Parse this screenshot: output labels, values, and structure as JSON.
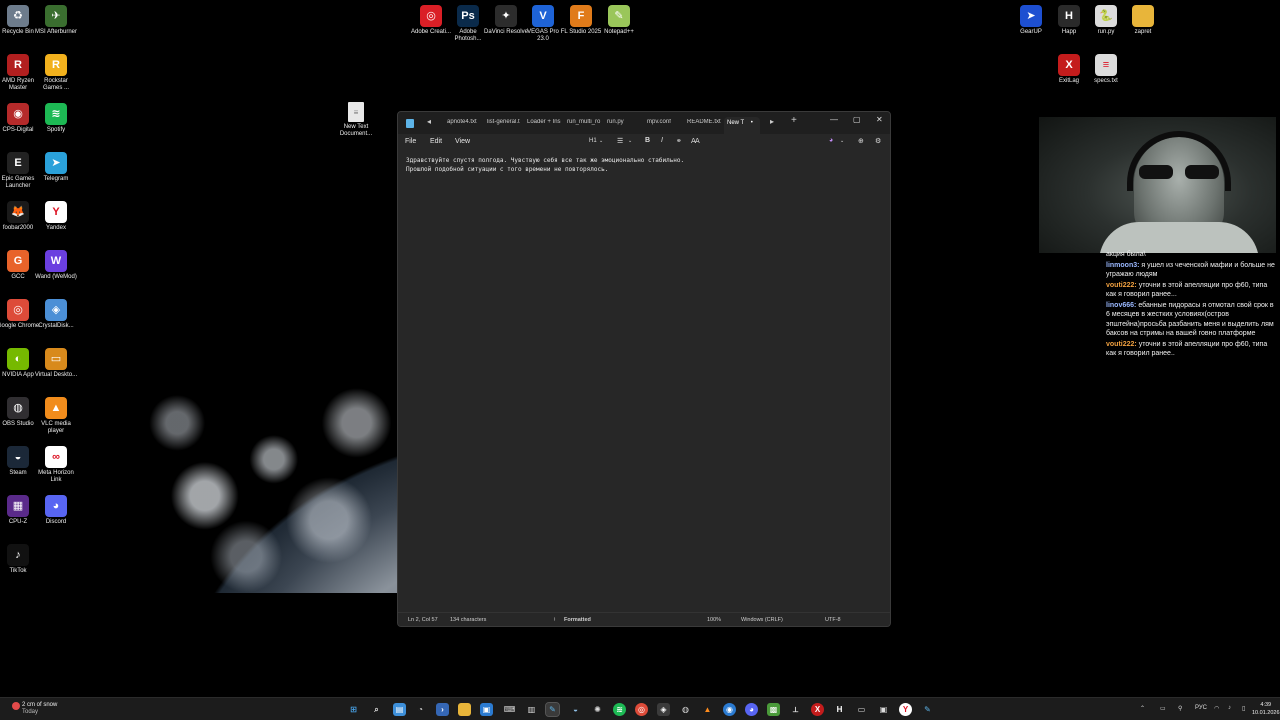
{
  "desktop": {
    "left_icons": [
      {
        "label": "Recycle Bin",
        "icon": "recycle-bin-icon",
        "color": "#6d7c8c",
        "glyph": "♻"
      },
      {
        "label": "MSI Afterburner",
        "icon": "msi-afterburner-icon",
        "color": "#3a6e2f",
        "glyph": "✈"
      },
      {
        "label": "AMD Ryzen Master",
        "icon": "amd-ryzen-icon",
        "color": "#b21f1f",
        "glyph": "R"
      },
      {
        "label": "Rockstar Games ...",
        "icon": "rockstar-icon",
        "color": "#f2b11d",
        "glyph": "R"
      },
      {
        "label": "CPS-Digital",
        "icon": "cps-digital-icon",
        "color": "#b52a2a",
        "glyph": "◉"
      },
      {
        "label": "Spotify",
        "icon": "spotify-icon",
        "color": "#1db954",
        "glyph": "≋"
      },
      {
        "label": "Epic Games Launcher",
        "icon": "epic-games-icon",
        "color": "#222222",
        "glyph": "E"
      },
      {
        "label": "Telegram",
        "icon": "telegram-icon",
        "color": "#2aa1da",
        "glyph": "➤"
      },
      {
        "label": "foobar2000",
        "icon": "foobar-icon",
        "color": "#1a1a1a",
        "glyph": "🦊"
      },
      {
        "label": "Yandex",
        "icon": "yandex-icon",
        "color": "#ffffff",
        "glyph": "Y"
      },
      {
        "label": "GCC",
        "icon": "gcc-icon",
        "color": "#e8632a",
        "glyph": "G"
      },
      {
        "label": "Wand (WeMod)",
        "icon": "wand-icon",
        "color": "#6b3fe0",
        "glyph": "W"
      },
      {
        "label": "Google Chrome",
        "icon": "chrome-icon",
        "color": "#dd4b39",
        "glyph": "◎"
      },
      {
        "label": "CrystalDisk...",
        "icon": "crystaldisk-icon",
        "color": "#4b8fd6",
        "glyph": "◈"
      },
      {
        "label": "NVIDIA App",
        "icon": "nvidia-icon",
        "color": "#76b900",
        "glyph": "◐"
      },
      {
        "label": "Virtual Deskto...",
        "icon": "virtual-desktop-icon",
        "color": "#d88a1c",
        "glyph": "▭"
      },
      {
        "label": "OBS Studio",
        "icon": "obs-icon",
        "color": "#302e31",
        "glyph": "◍"
      },
      {
        "label": "VLC media player",
        "icon": "vlc-icon",
        "color": "#f18c1c",
        "glyph": "▲"
      },
      {
        "label": "Steam",
        "icon": "steam-icon",
        "color": "#1b2838",
        "glyph": "◒"
      },
      {
        "label": "Meta Horizon Link",
        "icon": "meta-icon",
        "color": "#ffffff",
        "glyph": "∞"
      },
      {
        "label": "CPU-Z",
        "icon": "cpuz-icon",
        "color": "#5a2a8a",
        "glyph": "▦"
      },
      {
        "label": "Discord",
        "icon": "discord-icon",
        "color": "#5865f2",
        "glyph": "◕"
      },
      {
        "label": "TikTok",
        "icon": "tiktok-icon",
        "color": "#111111",
        "glyph": "♪"
      }
    ],
    "top_icons": [
      {
        "label": "Adobe Creati...",
        "icon": "adobe-cc-icon",
        "color": "#da1f26",
        "glyph": "◎"
      },
      {
        "label": "Adobe Photosh...",
        "icon": "photoshop-icon",
        "color": "#0a2a4a",
        "glyph": "Ps"
      },
      {
        "label": "DaVinci Resolve",
        "icon": "davinci-icon",
        "color": "#2c2c2c",
        "glyph": "✦"
      },
      {
        "label": "VEGAS Pro 23.0",
        "icon": "vegas-icon",
        "color": "#1e63d6",
        "glyph": "V"
      },
      {
        "label": "FL Studio 2025",
        "icon": "flstudio-icon",
        "color": "#e07b1a",
        "glyph": "F"
      },
      {
        "label": "Notepad++",
        "icon": "notepadpp-icon",
        "color": "#9ac65a",
        "glyph": "✎"
      }
    ],
    "right_icons": [
      {
        "label": "GearUP",
        "icon": "gearup-icon",
        "color": "#1d4fd1",
        "glyph": "➤"
      },
      {
        "label": "Happ",
        "icon": "happ-icon",
        "color": "#2a2a2a",
        "glyph": "H"
      },
      {
        "label": "run.py",
        "icon": "python-file-icon",
        "color": "#dcdcdc",
        "glyph": "🐍"
      },
      {
        "label": "zapret",
        "icon": "folder-icon",
        "color": "#e8b53a",
        "glyph": ""
      },
      {
        "label": "ExitLag",
        "icon": "exitlag-icon",
        "color": "#c41c1c",
        "glyph": "X"
      },
      {
        "label": "specs.txt",
        "icon": "text-file-icon",
        "color": "#dcdcdc",
        "glyph": "≡"
      }
    ],
    "file_icon": {
      "label": "New Text Document...",
      "icon": "text-file-icon"
    }
  },
  "notepad": {
    "tabs": [
      {
        "label": "apnote4.txt"
      },
      {
        "label": "list-general.t"
      },
      {
        "label": "Loader + Ins"
      },
      {
        "label": "run_multi_ro"
      },
      {
        "label": "run.py"
      },
      {
        "label": "mpv.conf"
      },
      {
        "label": "README.txt"
      },
      {
        "label": "New T"
      }
    ],
    "menu": {
      "file": "File",
      "edit": "Edit",
      "view": "View"
    },
    "format_heading": "H1",
    "format_bold": "B",
    "format_italic": "I",
    "content_lines": [
      "Здравствуйте спустя полгода. Чувствую себя все так же эмоционально стабильно.",
      "Прошлой подобной ситуации с того времени не повторялось."
    ],
    "status": {
      "position": "Ln 2, Col 57",
      "characters": "134 characters",
      "mode": "Formatted",
      "zoom": "100%",
      "line_ending": "Windows (CRLF)",
      "encoding": "UTF-8"
    }
  },
  "chat": {
    "messages": [
      {
        "nick": "",
        "color": "#f1f1f1",
        "text": "акция была\\"
      },
      {
        "nick": "linmoon3:",
        "color": "#9ab8ff",
        "text": "я ушел из чеченской мафии и больше не угражаю людям"
      },
      {
        "nick": "vouti222:",
        "color": "#f0a040",
        "text": "уточни в этой апелляции про ф60, типа как я говорил ранее..."
      },
      {
        "nick": "linov666:",
        "color": "#9ab8ff",
        "text": "ебанные пидорасы я отмотал свой срок в 6 месяцев в жестких условиях(остров эпштейна)просьба разбанить меня и выделить лям баксов на стримы на вашей говно платформе"
      },
      {
        "nick": "vouti222:",
        "color": "#f0a040",
        "text": "уточни в этой апелляции про ф60, типа как я говорил ранее.."
      }
    ]
  },
  "taskbar": {
    "weather_text": "2 cm of snow",
    "weather_sub": "Today",
    "language": "РУС",
    "time": "4:39",
    "date": "10.01.2026"
  }
}
